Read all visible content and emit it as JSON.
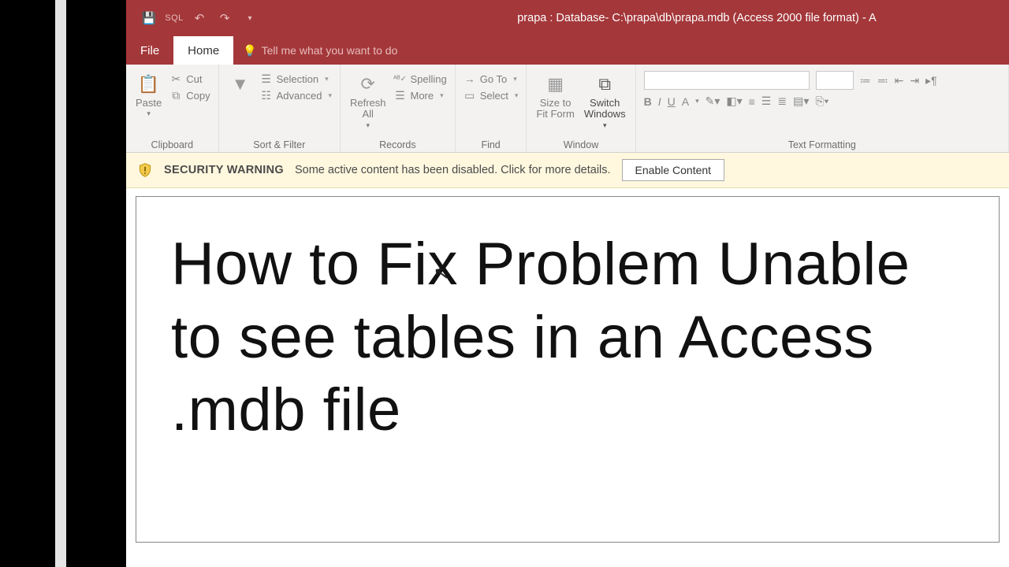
{
  "titlebar": {
    "title": "prapa : Database- C:\\prapa\\db\\prapa.mdb (Access 2000 file format)  -  A",
    "qat": {
      "save": "save",
      "sql": "SQL",
      "undo": "↶",
      "redo": "↷",
      "more": "▾"
    }
  },
  "tabs": {
    "file": "File",
    "home": "Home",
    "tell": "Tell me what you want to do"
  },
  "ribbon": {
    "clipboard": {
      "paste": "Paste",
      "cut": "Cut",
      "copy": "Copy",
      "label": "Clipboard"
    },
    "sortfilter": {
      "selection": "Selection",
      "advanced": "Advanced",
      "filter_icon": "filter",
      "label": "Sort & Filter"
    },
    "records": {
      "refresh": "Refresh\nAll",
      "spelling": "Spelling",
      "more": "More",
      "label": "Records"
    },
    "find": {
      "goto": "Go To",
      "select": "Select",
      "label": "Find"
    },
    "window": {
      "size": "Size to\nFit Form",
      "switch": "Switch\nWindows",
      "label": "Window"
    },
    "textfmt": {
      "label": "Text Formatting",
      "bold": "B",
      "italic": "I",
      "underline": "U",
      "fontcolor": "A"
    }
  },
  "security": {
    "heading": "SECURITY WARNING",
    "msg": "Some active content has been disabled. Click for more details.",
    "button": "Enable Content"
  },
  "document": {
    "text": "How to Fix Problem Unable to see tables in an Access .mdb file"
  }
}
